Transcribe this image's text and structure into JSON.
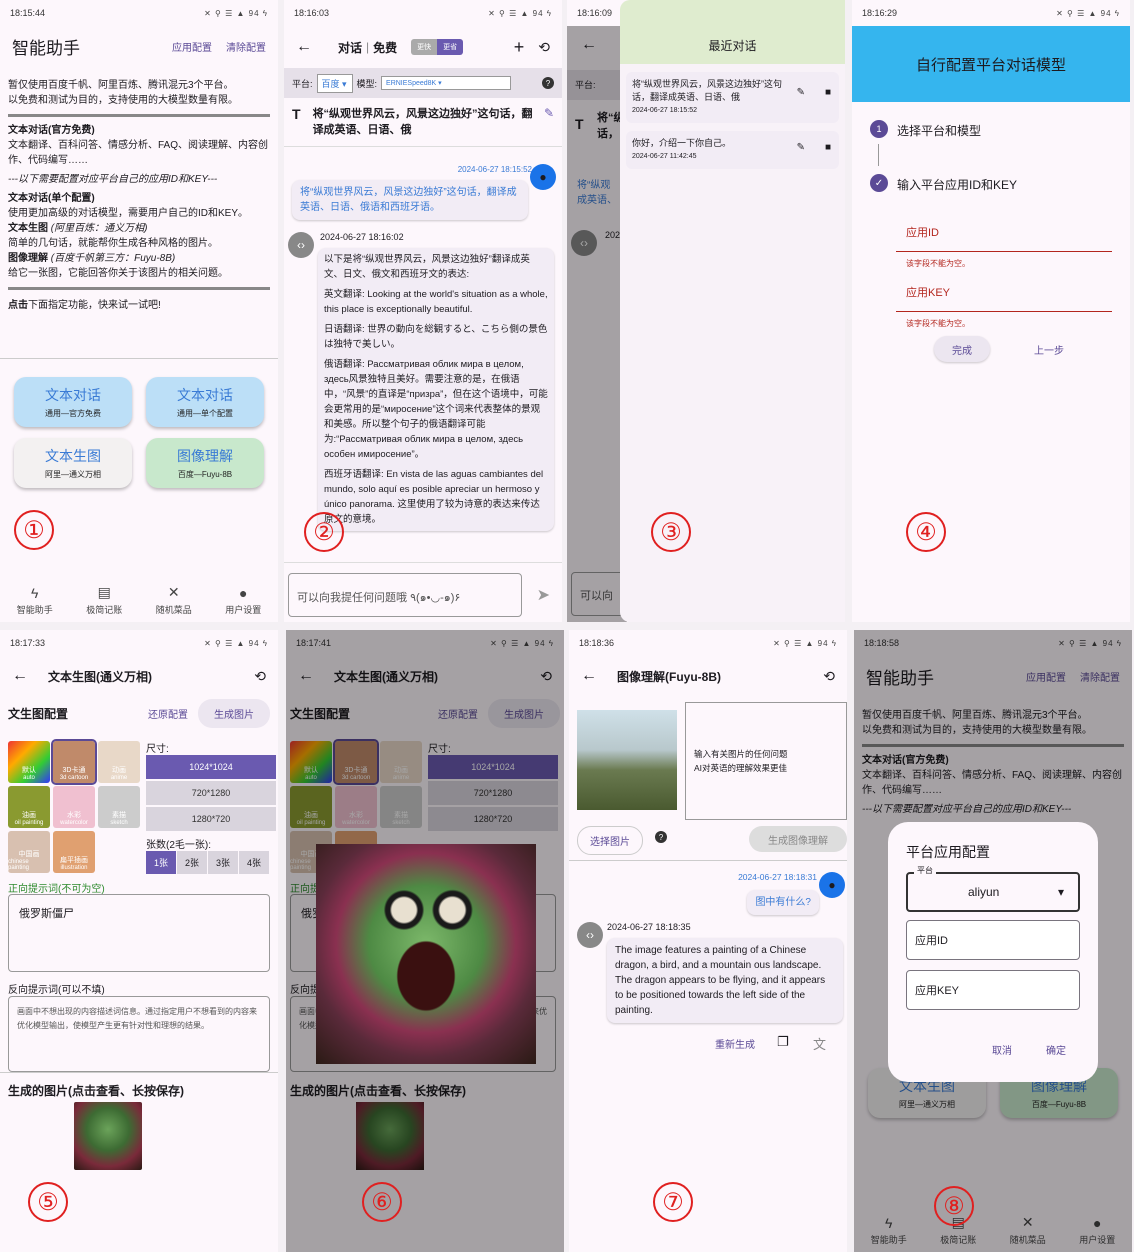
{
  "status": {
    "icons": "✕ ⚲ ☰ ▲ 94 ϟ",
    "t1": "18:15:44",
    "t2": "18:16:03",
    "t3": "18:16:09",
    "t4": "18:16:29",
    "t5": "18:17:33",
    "t6": "18:17:41",
    "t7": "18:18:36",
    "t8": "18:18:58"
  },
  "p1": {
    "title": "智能助手",
    "cfg": "应用配置",
    "clear": "清除配置",
    "l1": "暂仅使用百度千帆、阿里百炼、腾讯混元3个平台。",
    "l2": "以免费和测试为目的，支持使用的大模型数量有限。",
    "h1": "文本对话(官方免费)",
    "l3": "文本翻译、百科问答、情感分析、FAQ、阅读理解、内容创作、代码编写……",
    "l4": "---以下需要配置对应平台自己的应用ID和KEY---",
    "h2": "文本对话(单个配置)",
    "l5": "使用更加高级的对话模型，需要用户自己的ID和KEY。",
    "h3": "文本生图",
    "h3s": "(阿里百炼：通义万相)",
    "l6": "简单的几句话，就能帮你生成各种风格的图片。",
    "h4": "图像理解",
    "h4s": "(百度千帆第三方：Fuyu-8B)",
    "l7": "给它一张图，它能回答你关于该图片的相关问题。",
    "l8b": "点击",
    "l8": "下面指定功能，快来试一试吧!",
    "b1": "文本对话",
    "b1s": "通用—官方免费",
    "b2": "文本对话",
    "b2s": "通用—单个配置",
    "b3": "文本生图",
    "b3s": "阿里—通义万相",
    "b4": "图像理解",
    "b4s": "百度—Fuyu-8B",
    "num": "①"
  },
  "nav": {
    "n1": "智能助手",
    "n2": "极简记账",
    "n3": "随机菜品",
    "n4": "用户设置"
  },
  "p2": {
    "title": "对话",
    "sep": "|",
    "free": "免费",
    "s1": "更快",
    "s2": "更省",
    "plat": "平台:",
    "platv": "百度",
    "model": "模型:",
    "modelv": "ERNIESpeed8K",
    "head": "将“纵观世界风云，风景这边独好”这句话，翻译成英语、日语、俄",
    "t1": "2024-06-27 18:15:52",
    "q": "将“纵观世界风云，风景这边独好”这句话，翻译成英语、日语、俄语和西班牙语。",
    "t2": "2024-06-27 18:16:02",
    "a1": "以下是将“纵观世界风云，风景这边独好”翻译成英文、日文、俄文和西班牙文的表达:",
    "a2": "英文翻译: Looking at the world's situation as a whole, this place is exceptionally beautiful.",
    "a3": "日语翻译: 世界の動向を総観すると、こちら側の景色は独特で美しい。",
    "a4": "俄语翻译: Рассматривая облик мира в целом, здесь风景独特且美好。需要注意的是，在俄语中，“风景”的直译是“призра”，但在这个语境中，可能会更常用的是“мироcение”这个词来代表整体的景观和美感。所以整个句子的俄语翻译可能为:“Рассматривая облик мира в целом, здесь особен имиросение”。",
    "a5": "西班牙语翻译: En vista de las aguas cambiantes del mundo, solo aquí es posible apreciar un hermoso y único panorama. 这里使用了较为诗意的表达来传达原文的意境。",
    "input": "可以向我提任何问题哦 ٩(๑•◡-๑)۶",
    "num": "②"
  },
  "p3": {
    "head": "最近对话",
    "c1": "将“纵观世界风云，风景这边独好”这句话，翻译成英语、日语、俄",
    "c1t": "2024-06-27 18:15:52",
    "c2": "你好，介绍一下你自己。",
    "c2t": "2024-06-27 11:42:45",
    "num": "③",
    "bg1": "将“纵",
    "bg2": "话，",
    "bg3": "将“纵观",
    "bg4": "成英语、",
    "bg5": "202",
    "bg6": "可以向"
  },
  "p4": {
    "title": "自行配置平台对话模型",
    "st1": "选择平台和模型",
    "st2": "输入平台应用ID和KEY",
    "f1": "应用ID",
    "e1": "该字段不能为空。",
    "f2": "应用KEY",
    "e2": "该字段不能为空。",
    "done": "完成",
    "prev": "上一步",
    "num": "④"
  },
  "p5": {
    "title": "文本生图(通义万相)",
    "cfg": "文生图配置",
    "reset": "还原配置",
    "gen": "生成图片",
    "size": "尺寸:",
    "s1": "1024*1024",
    "s2": "720*1280",
    "s3": "1280*720",
    "cnt": "张数(2毛一张):",
    "c1": "1张",
    "c2": "2张",
    "c3": "3张",
    "c4": "4张",
    "th": [
      "默认",
      "3D卡通",
      "动画",
      "油画",
      "水彩",
      "素描",
      "中国画",
      "扁平插画"
    ],
    "thsub": [
      "auto",
      "3d cartoon",
      "anime",
      "oil painting",
      "watercolor",
      "sketch",
      "chinese painting",
      "illustration"
    ],
    "pos": "正向提示词(不可为空)",
    "posv": "俄罗斯僵尸",
    "neg": "反向提示词(可以不填)",
    "negv": "画面中不想出现的内容描述词信息。通过指定用户不想看到的内容来优化模型输出，使模型产生更有针对性和理想的结果。",
    "gen_title": "生成的图片(点击查看、长按保存)",
    "num": "⑤"
  },
  "p6": {
    "num": "⑥"
  },
  "p7": {
    "title": "图像理解(Fuyu-8B)",
    "ph": "输入有关图片的任何问题\nAI对英语的理解效果更佳",
    "pick": "选择图片",
    "genb": "生成图像理解",
    "t1": "2024-06-27 18:18:31",
    "q": "图中有什么?",
    "t2": "2024-06-27 18:18:35",
    "a": "The image features a painting of a Chinese dragon, a bird, and a mountain ous landscape. The dragon appears to be flying, and it appears to be positioned towards the left side of the painting.",
    "regen": "重新生成",
    "num": "⑦"
  },
  "p8": {
    "dtitle": "平台应用配置",
    "plat": "平台",
    "platv": "aliyun",
    "f1": "应用ID",
    "f2": "应用KEY",
    "cancel": "取消",
    "ok": "确定",
    "bg_b3s": "阿里—通义万相",
    "bg_b4s": "百度—Fuyu-8B",
    "bg_l1": "暂仅使用百度千帆、阿里百炼、腾讯混元3个平台。",
    "bg_l2": "以免费和测试为目的，支持使用的大模型数量有限。",
    "num": "⑧"
  }
}
